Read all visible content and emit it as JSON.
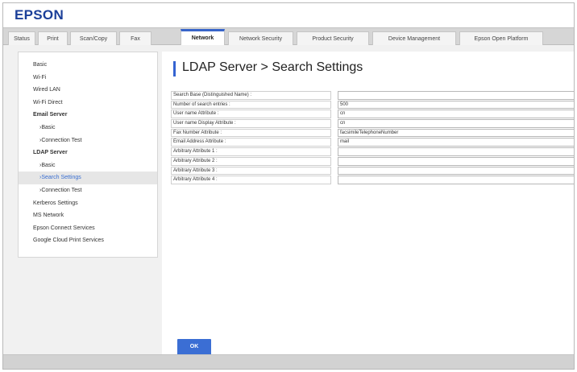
{
  "brand": {
    "logo_text": "EPSON",
    "brand_color": "#1b3f99",
    "accent_color": "#3463d1"
  },
  "tabs": [
    {
      "label": "Status"
    },
    {
      "label": "Print"
    },
    {
      "label": "Scan/Copy"
    },
    {
      "label": "Fax"
    },
    {
      "label": "Network",
      "active": true
    },
    {
      "label": "Network Security"
    },
    {
      "label": "Product Security"
    },
    {
      "label": "Device Management"
    },
    {
      "label": "Epson Open Platform"
    }
  ],
  "sidebar": {
    "items": [
      {
        "label": "Basic"
      },
      {
        "label": "Wi-Fi"
      },
      {
        "label": "Wired LAN"
      },
      {
        "label": "Wi-Fi Direct"
      },
      {
        "label": "Email Server",
        "section": true
      },
      {
        "label": "›Basic"
      },
      {
        "label": "›Connection Test"
      },
      {
        "label": "LDAP Server",
        "section": true
      },
      {
        "label": "›Basic"
      },
      {
        "label": "›Search Settings",
        "selected": true
      },
      {
        "label": "›Connection Test"
      },
      {
        "label": "Kerberos Settings"
      },
      {
        "label": "MS Network"
      },
      {
        "label": "Epson Connect Services"
      },
      {
        "label": "Google Cloud Print Services"
      }
    ]
  },
  "main": {
    "title": "LDAP Server > Search Settings",
    "fields": [
      {
        "label": "Search Base (Distinguished Name) :",
        "value": ""
      },
      {
        "label": "Number of search entries :",
        "value": "500"
      },
      {
        "label": "User name Attribute :",
        "value": "cn"
      },
      {
        "label": "User name Display Attribute :",
        "value": "cn"
      },
      {
        "label": "Fax Number Attribute :",
        "value": "facsimileTelephoneNumber"
      },
      {
        "label": "Email Address Attribute :",
        "value": "mail"
      },
      {
        "label": "Arbitrary Attribute 1 :",
        "value": ""
      },
      {
        "label": "Arbitrary Attribute 2 :",
        "value": ""
      },
      {
        "label": "Arbitrary Attribute 3 :",
        "value": ""
      },
      {
        "label": "Arbitrary Attribute 4 :",
        "value": ""
      }
    ],
    "ok_label": "OK"
  }
}
